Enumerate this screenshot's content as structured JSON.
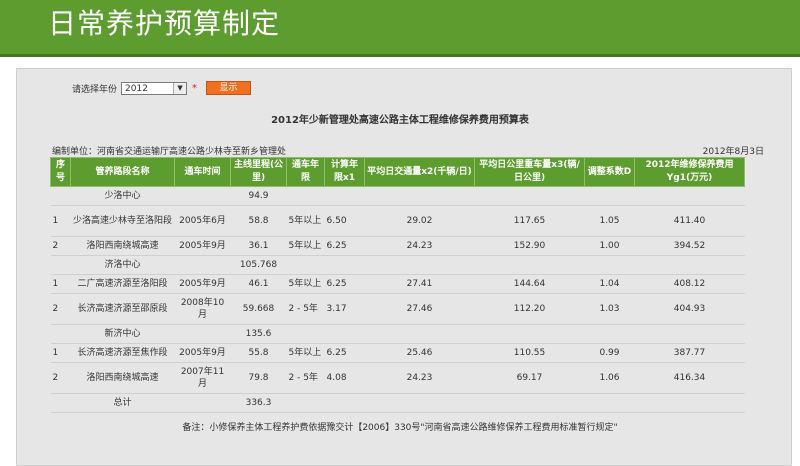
{
  "banner": {
    "title": "日常养护预算制定"
  },
  "controls": {
    "year_label": "请选择年份",
    "year_value": "2012",
    "required_mark": "*",
    "show_button": "显示"
  },
  "report": {
    "title": "2012年少新管理处高速公路主体工程维修保养费用预算表",
    "unit": "编制单位：河南省交通运输厅高速公路少林寺至新乡管理处",
    "date": "2012年8月3日",
    "note": "备注：小修保养主体工程养护费依据豫交计【2006】330号\"河南省高速公路维修保养工程费用标准暂行规定\""
  },
  "table": {
    "headers": [
      "序号",
      "管养路段名称",
      "通车时间",
      "主线里程(公里)",
      "通车年限",
      "计算年限x1",
      "平均日交通量x2(千辆/日)",
      "平均日公里重车量x3(辆/日公里)",
      "调整系数D",
      "2012年维修保养费用Yg1(万元)"
    ],
    "rows": [
      {
        "cells": [
          "",
          "少洛中心",
          "",
          "94.9",
          "",
          "",
          "",
          "",
          "",
          ""
        ]
      },
      {
        "cells": [
          "1",
          "少洛高速少林寺至洛阳段",
          "2005年6月",
          "58.8",
          "5年以上",
          "6.50",
          "29.02",
          "117.65",
          "1.05",
          "411.40"
        ]
      },
      {
        "cells": [
          "2",
          "洛阳西南绕城高速",
          "2005年9月",
          "36.1",
          "5年以上",
          "6.25",
          "24.23",
          "152.90",
          "1.00",
          "394.52"
        ]
      },
      {
        "cells": [
          "",
          "济洛中心",
          "",
          "105.768",
          "",
          "",
          "",
          "",
          "",
          ""
        ]
      },
      {
        "cells": [
          "1",
          "二广高速济源至洛阳段",
          "2005年9月",
          "46.1",
          "5年以上",
          "6.25",
          "27.41",
          "144.64",
          "1.04",
          "408.12"
        ]
      },
      {
        "cells": [
          "2",
          "长济高速济源至邵原段",
          "2008年10月",
          "59.668",
          "2 - 5年",
          "3.17",
          "27.46",
          "112.20",
          "1.03",
          "404.93"
        ]
      },
      {
        "cells": [
          "",
          "新济中心",
          "",
          "135.6",
          "",
          "",
          "",
          "",
          "",
          ""
        ]
      },
      {
        "cells": [
          "1",
          "长济高速济源至焦作段",
          "2005年9月",
          "55.8",
          "5年以上",
          "6.25",
          "25.46",
          "110.55",
          "0.99",
          "387.77"
        ]
      },
      {
        "cells": [
          "2",
          "洛阳西南绕城高速",
          "2007年11月",
          "79.8",
          "2 - 5年",
          "4.08",
          "24.23",
          "69.17",
          "1.06",
          "416.34"
        ]
      },
      {
        "cells": [
          "",
          "总计",
          "",
          "336.3",
          "",
          "",
          "",
          "",
          "",
          ""
        ]
      }
    ]
  }
}
